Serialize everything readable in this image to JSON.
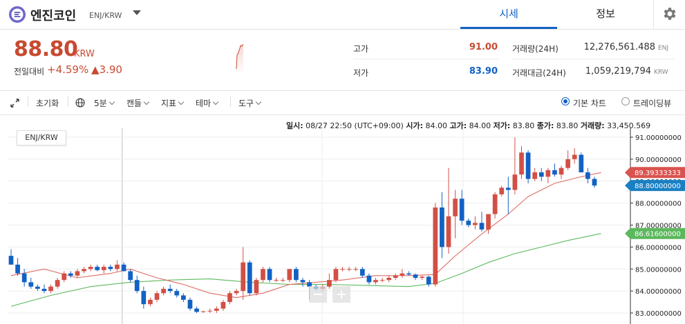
{
  "header": {
    "coin_name": "엔진코인",
    "coin_pair": "ENJ/KRW",
    "tabs": [
      {
        "label": "시세",
        "active": true
      },
      {
        "label": "정보",
        "active": false
      }
    ],
    "icons": {
      "logo": "enjin-logo-icon",
      "dropdown": "chevron-down-icon",
      "settings": "gear-icon"
    }
  },
  "ticker": {
    "price": "88.80",
    "unit": "KRW",
    "change_label": "전일대비",
    "change_pct": "+4.59%",
    "change_abs": "▲3.90",
    "high_label": "고가",
    "high": "91.00",
    "low_label": "저가",
    "low": "83.90",
    "volume_label": "거래량(24H)",
    "volume": "12,276,561.488",
    "volume_unit": "ENJ",
    "value_label": "거래대금(24H)",
    "value": "1,059,219,794",
    "value_unit": "KRW"
  },
  "toolbar": {
    "reset": "초기화",
    "interval": "5분",
    "candle": "캔들",
    "indicator": "지표",
    "theme": "테마",
    "tools": "도구",
    "basic_chart": "기본 차트",
    "tradingview": "트레이딩뷰"
  },
  "info_bar": {
    "time_label": "일시:",
    "time": "08/27 22:50 (UTC+09:00)",
    "open_label": "시가:",
    "open": "84.00",
    "high_label": "고가:",
    "high": "84.00",
    "low_label": "저가:",
    "low": "83.80",
    "close_label": "종가:",
    "close": "83.80",
    "volume_label": "거래량:",
    "volume": "33,450.569"
  },
  "chart_data": {
    "type": "candlestick",
    "pair_label": "ENJ/KRW",
    "ylim": [
      82.9,
      91.2
    ],
    "y_ticks": [
      "83.00000000",
      "84.00000000",
      "85.00000000",
      "86.00000000",
      "87.00000000",
      "88.00000000",
      "89.00000000",
      "90.00000000",
      "91.00000000"
    ],
    "price_tags": [
      {
        "value": "89.39333333",
        "num": 89.39333333,
        "color": "#d9534f"
      },
      {
        "value": "88.80000000",
        "num": 88.8,
        "color": "#1a80c4"
      },
      {
        "value": "86.61600000",
        "num": 86.616,
        "color": "#5cb85c"
      }
    ],
    "up_color": "#d24f45",
    "down_color": "#1261c4",
    "candles": [
      [
        85.6,
        85.9,
        85.2,
        85.2
      ],
      [
        85.2,
        85.5,
        84.7,
        84.8
      ],
      [
        84.8,
        85.0,
        84.2,
        84.4
      ],
      [
        84.4,
        84.6,
        84.1,
        84.2
      ],
      [
        84.2,
        84.3,
        84.0,
        84.1
      ],
      [
        84.1,
        84.3,
        83.9,
        84.0
      ],
      [
        84.0,
        84.3,
        83.9,
        84.2
      ],
      [
        84.2,
        84.6,
        84.1,
        84.5
      ],
      [
        84.5,
        84.9,
        84.4,
        84.8
      ],
      [
        84.8,
        84.9,
        84.6,
        84.7
      ],
      [
        84.7,
        85.0,
        84.6,
        84.9
      ],
      [
        84.9,
        85.1,
        84.8,
        85.0
      ],
      [
        85.0,
        85.2,
        84.9,
        85.1
      ],
      [
        85.1,
        85.2,
        84.9,
        84.95
      ],
      [
        84.95,
        85.2,
        84.8,
        85.1
      ],
      [
        85.1,
        85.2,
        84.9,
        85.0
      ],
      [
        85.0,
        85.4,
        84.9,
        85.2
      ],
      [
        85.2,
        85.3,
        84.9,
        84.9
      ],
      [
        84.9,
        85.0,
        84.4,
        84.5
      ],
      [
        84.5,
        84.7,
        83.9,
        84.0
      ],
      [
        84.0,
        84.2,
        83.2,
        83.4
      ],
      [
        83.4,
        83.7,
        83.3,
        83.6
      ],
      [
        83.6,
        84.0,
        83.5,
        83.9
      ],
      [
        83.9,
        84.2,
        83.8,
        84.1
      ],
      [
        84.1,
        84.3,
        83.9,
        84.0
      ],
      [
        84.0,
        84.1,
        83.7,
        83.8
      ],
      [
        83.8,
        83.9,
        83.5,
        83.6
      ],
      [
        83.6,
        83.7,
        83.1,
        83.2
      ],
      [
        83.2,
        83.3,
        83.0,
        83.05
      ],
      [
        83.05,
        83.1,
        83.0,
        83.08
      ],
      [
        83.08,
        83.2,
        83.0,
        83.1
      ],
      [
        83.1,
        83.3,
        83.0,
        83.2
      ],
      [
        83.2,
        83.6,
        83.1,
        83.5
      ],
      [
        83.5,
        84.0,
        83.4,
        83.9
      ],
      [
        83.9,
        84.1,
        83.8,
        84.0
      ],
      [
        84.0,
        86.0,
        83.6,
        85.3
      ],
      [
        85.3,
        85.4,
        83.8,
        83.9
      ],
      [
        83.9,
        84.6,
        83.8,
        84.5
      ],
      [
        84.5,
        85.1,
        84.4,
        85.0
      ],
      [
        85.0,
        85.1,
        84.4,
        84.5
      ],
      [
        84.5,
        84.6,
        84.4,
        84.5
      ],
      [
        84.5,
        84.6,
        84.4,
        84.5
      ],
      [
        84.5,
        85.0,
        84.4,
        85.0
      ],
      [
        85.0,
        85.1,
        84.4,
        84.5
      ],
      [
        84.5,
        84.6,
        84.2,
        84.4
      ],
      [
        84.4,
        84.5,
        83.6,
        84.2
      ],
      [
        84.2,
        84.3,
        84.0,
        84.1
      ],
      [
        84.1,
        84.3,
        84.0,
        84.2
      ],
      [
        84.2,
        84.8,
        84.1,
        84.5
      ],
      [
        84.5,
        85.1,
        84.4,
        85.0
      ],
      [
        85.0,
        85.1,
        84.9,
        85.0
      ],
      [
        85.0,
        85.1,
        84.9,
        85.0
      ],
      [
        85.0,
        85.1,
        84.9,
        85.0
      ],
      [
        85.0,
        85.1,
        84.6,
        84.7
      ],
      [
        84.7,
        84.8,
        84.3,
        84.4
      ],
      [
        84.4,
        84.6,
        84.3,
        84.5
      ],
      [
        84.5,
        84.6,
        84.4,
        84.5
      ],
      [
        84.5,
        84.7,
        84.4,
        84.6
      ],
      [
        84.6,
        84.8,
        84.5,
        84.7
      ],
      [
        84.7,
        85.0,
        84.6,
        84.8
      ],
      [
        84.8,
        84.9,
        84.7,
        84.75
      ],
      [
        84.75,
        84.8,
        84.5,
        84.6
      ],
      [
        84.6,
        84.7,
        84.5,
        84.65
      ],
      [
        84.65,
        84.7,
        84.2,
        84.3
      ],
      [
        84.3,
        88.0,
        84.2,
        87.8
      ],
      [
        87.8,
        88.5,
        85.5,
        86.0
      ],
      [
        86.0,
        89.6,
        85.7,
        87.4
      ],
      [
        87.4,
        88.6,
        86.4,
        88.2
      ],
      [
        88.2,
        88.6,
        87.0,
        87.2
      ],
      [
        87.2,
        87.3,
        86.9,
        87.0
      ],
      [
        87.0,
        87.4,
        86.8,
        87.1
      ],
      [
        87.1,
        87.6,
        86.7,
        86.8
      ],
      [
        86.8,
        87.5,
        86.6,
        87.5
      ],
      [
        87.5,
        88.5,
        87.3,
        88.4
      ],
      [
        88.4,
        88.8,
        88.3,
        88.7
      ],
      [
        88.7,
        89.2,
        87.5,
        88.6
      ],
      [
        88.6,
        91.0,
        88.4,
        89.3
      ],
      [
        89.3,
        90.6,
        89.1,
        90.3
      ],
      [
        90.3,
        90.4,
        88.9,
        89.1
      ],
      [
        89.1,
        89.6,
        89.0,
        89.4
      ],
      [
        89.4,
        89.6,
        89.0,
        89.2
      ],
      [
        89.2,
        89.6,
        88.9,
        89.5
      ],
      [
        89.5,
        89.8,
        89.2,
        89.3
      ],
      [
        89.3,
        89.7,
        89.1,
        89.6
      ],
      [
        89.6,
        90.4,
        89.5,
        90.0
      ],
      [
        90.0,
        90.5,
        89.8,
        90.2
      ],
      [
        90.2,
        90.3,
        89.4,
        89.4
      ],
      [
        89.4,
        89.6,
        88.9,
        89.1
      ],
      [
        89.1,
        89.2,
        88.7,
        88.8
      ]
    ],
    "ma_short": [
      [
        0,
        84.7
      ],
      [
        5,
        85.0
      ],
      [
        10,
        84.6
      ],
      [
        15,
        84.8
      ],
      [
        18,
        85.0
      ],
      [
        22,
        84.6
      ],
      [
        26,
        84.3
      ],
      [
        30,
        83.9
      ],
      [
        34,
        83.7
      ],
      [
        38,
        83.9
      ],
      [
        42,
        84.3
      ],
      [
        46,
        84.4
      ],
      [
        50,
        84.5
      ],
      [
        55,
        84.7
      ],
      [
        60,
        84.7
      ],
      [
        64,
        84.75
      ],
      [
        67,
        85.6
      ],
      [
        71,
        86.6
      ],
      [
        75,
        87.5
      ],
      [
        78,
        88.3
      ],
      [
        82,
        88.9
      ],
      [
        86,
        89.2
      ],
      [
        89,
        89.39
      ]
    ],
    "ma_long": [
      [
        0,
        83.3
      ],
      [
        6,
        83.8
      ],
      [
        12,
        84.2
      ],
      [
        18,
        84.4
      ],
      [
        24,
        84.5
      ],
      [
        30,
        84.55
      ],
      [
        36,
        84.4
      ],
      [
        42,
        84.3
      ],
      [
        48,
        84.3
      ],
      [
        54,
        84.25
      ],
      [
        60,
        84.2
      ],
      [
        64,
        84.35
      ],
      [
        68,
        84.8
      ],
      [
        72,
        85.3
      ],
      [
        76,
        85.7
      ],
      [
        80,
        86.0
      ],
      [
        84,
        86.3
      ],
      [
        89,
        86.616
      ]
    ]
  }
}
